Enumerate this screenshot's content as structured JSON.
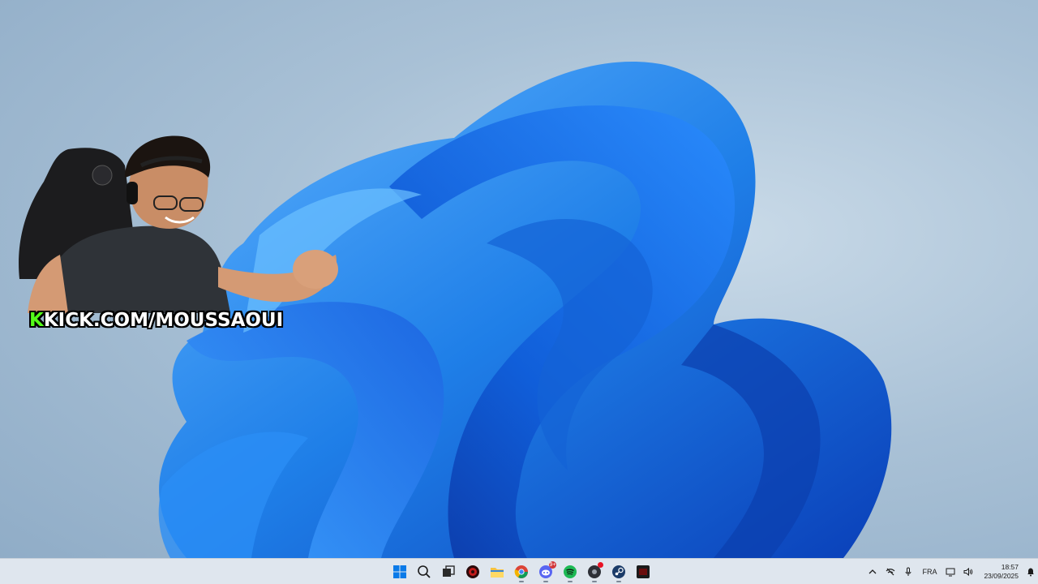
{
  "desktop": {
    "wallpaper": "windows-11-bloom",
    "accent": "#1a7fe8"
  },
  "overlay": {
    "streamer_link": "KICK.COM/MOUSSAOUI",
    "kick_color": "#53fc18"
  },
  "taskbar": {
    "apps": [
      {
        "name": "start",
        "icon": "windows-logo-icon"
      },
      {
        "name": "search",
        "icon": "search-icon"
      },
      {
        "name": "task-view",
        "icon": "task-view-icon"
      },
      {
        "name": "app-red",
        "icon": "red-circle-app-icon"
      },
      {
        "name": "file-explorer",
        "icon": "folder-icon"
      },
      {
        "name": "chrome",
        "icon": "chrome-icon"
      },
      {
        "name": "discord",
        "icon": "discord-icon",
        "badge": "9+"
      },
      {
        "name": "spotify",
        "icon": "spotify-icon"
      },
      {
        "name": "dark-app",
        "icon": "dark-circle-app-icon"
      },
      {
        "name": "steam",
        "icon": "steam-icon"
      },
      {
        "name": "terminal-app",
        "icon": "dark-square-app-icon"
      }
    ],
    "tray": {
      "language": "FRA",
      "time": "18:57",
      "date": "23/09/2025"
    }
  }
}
